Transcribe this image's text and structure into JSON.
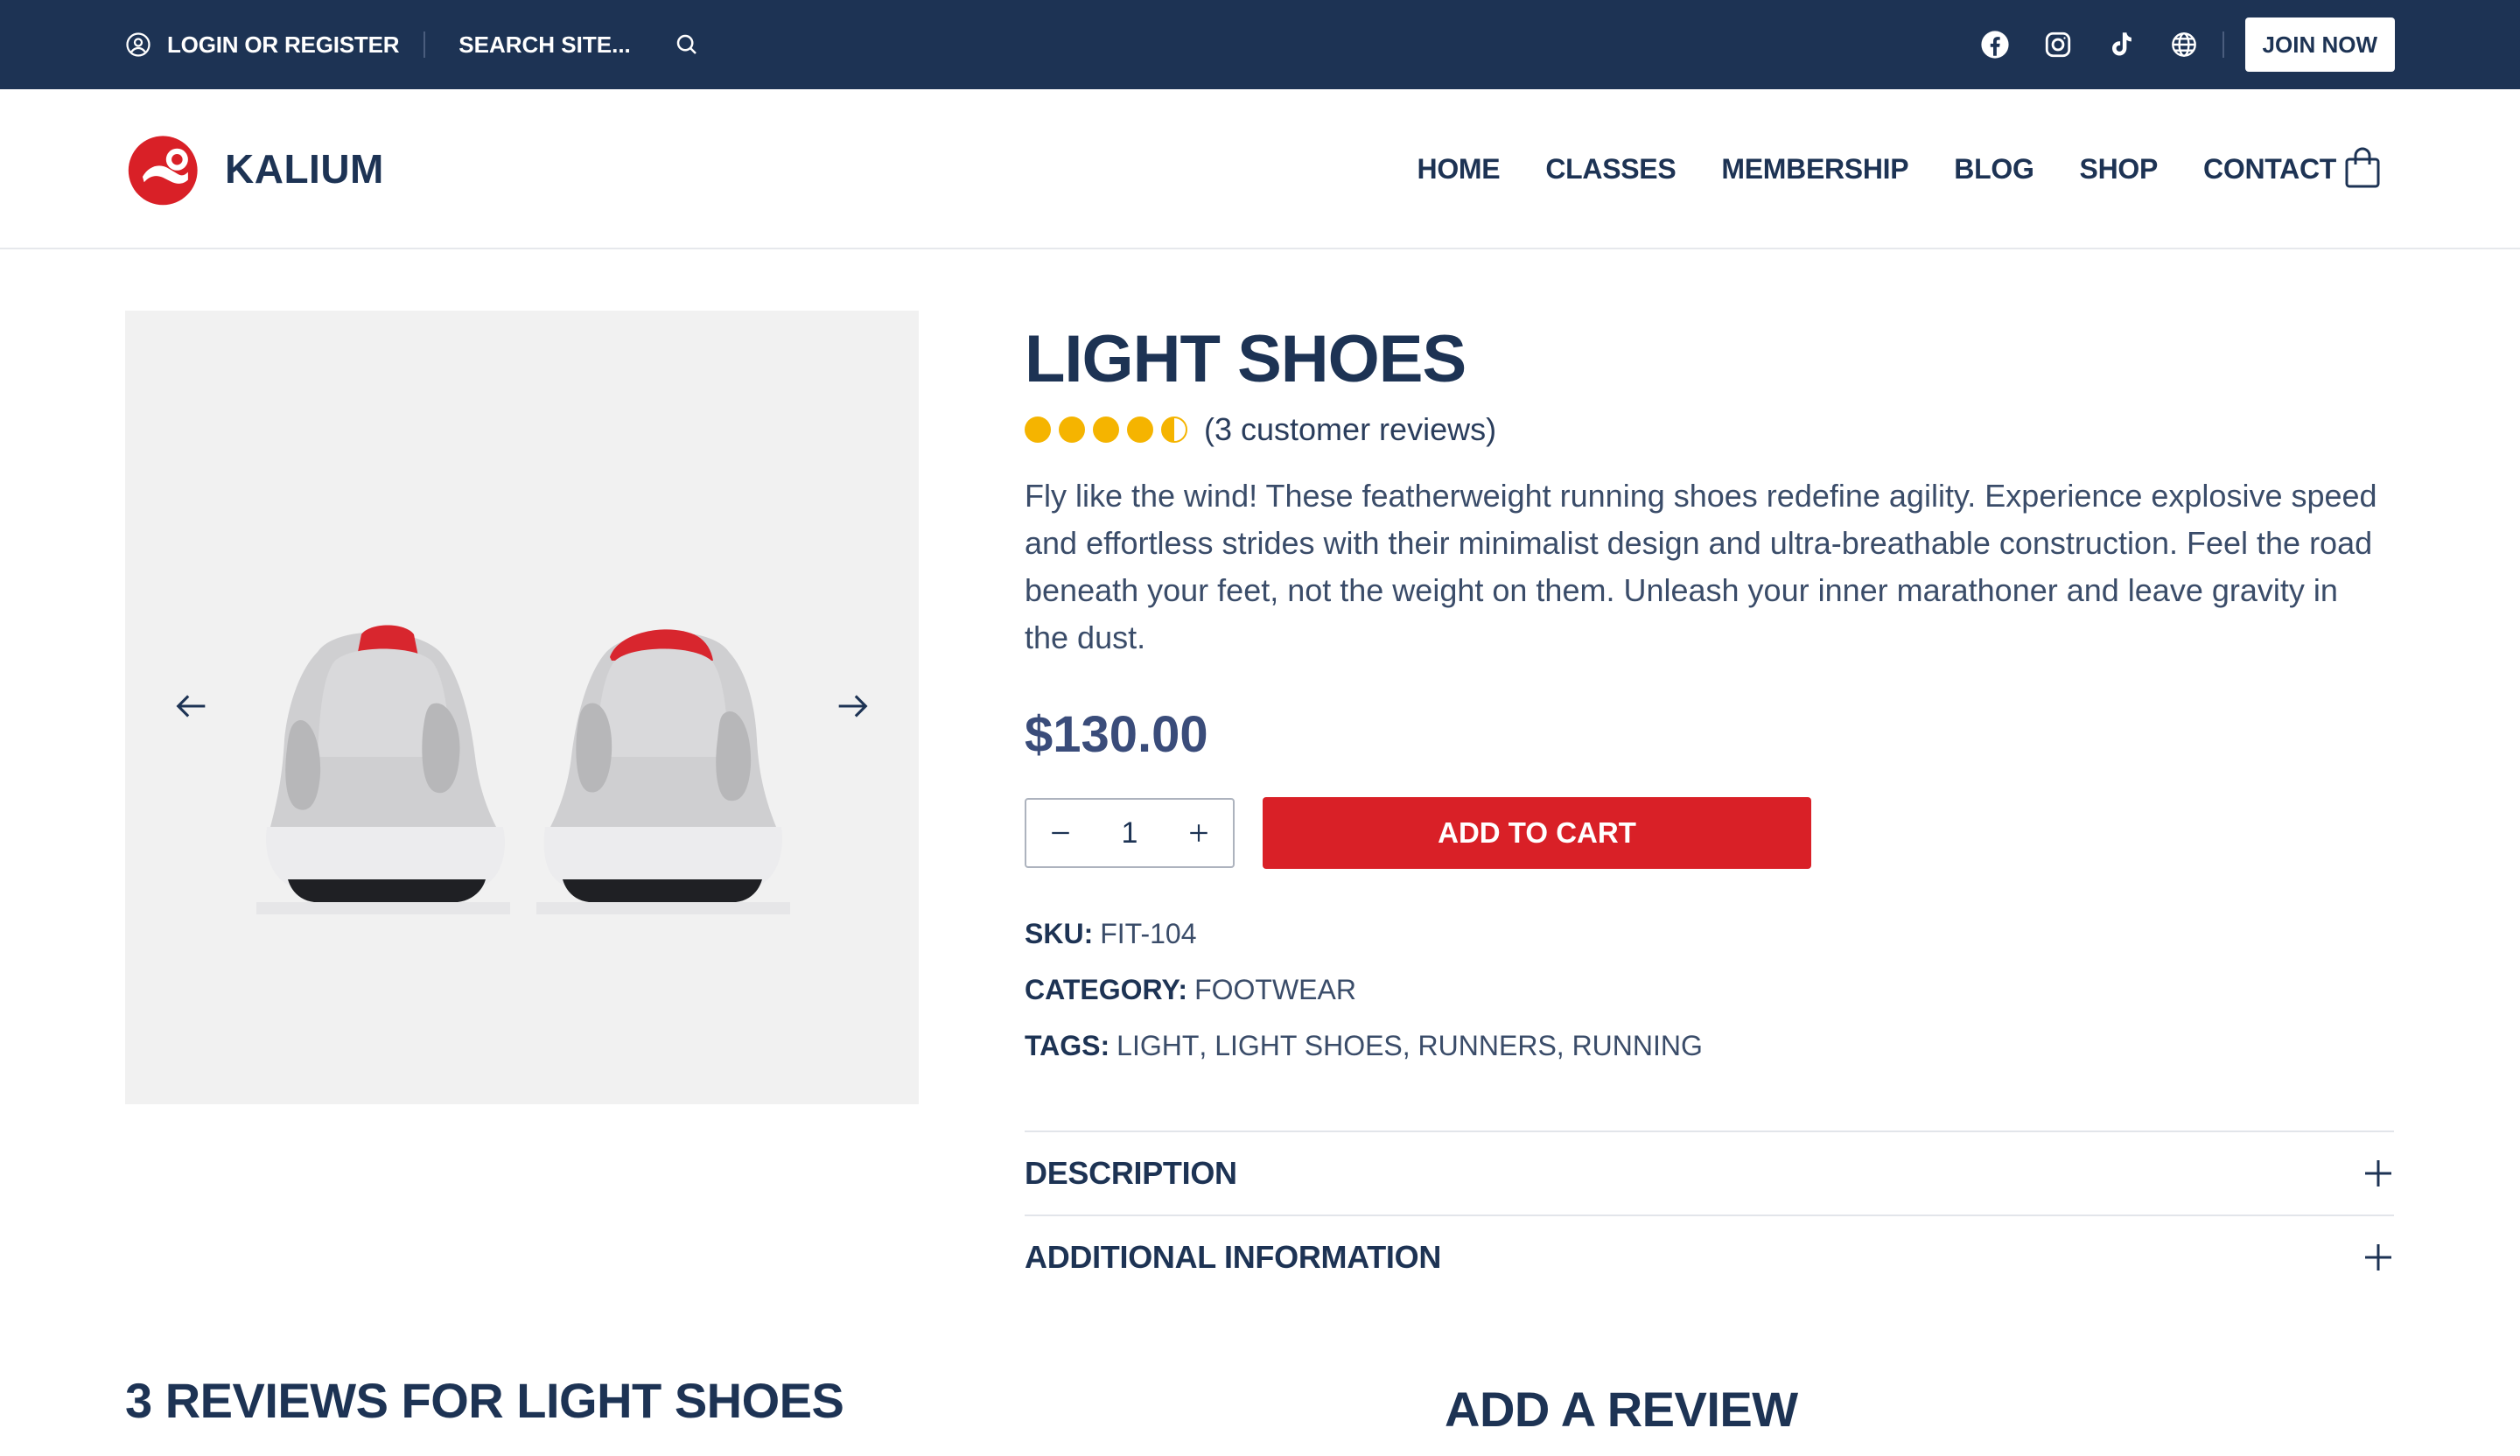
{
  "topbar": {
    "login_label": "LOGIN OR REGISTER",
    "search_placeholder": "SEARCH SITE...",
    "join_label": "JOIN NOW",
    "icons": [
      "user-icon",
      "search-icon",
      "facebook-icon",
      "instagram-icon",
      "tiktok-icon",
      "globe-icon"
    ]
  },
  "header": {
    "brand": "KALIUM",
    "nav": [
      "HOME",
      "CLASSES",
      "MEMBERSHIP",
      "BLOG",
      "SHOP",
      "CONTACT"
    ],
    "cart_icon": "shopping-bag-icon"
  },
  "product": {
    "title": "LIGHT SHOES",
    "rating": 4.5,
    "rating_max": 5,
    "reviews_text": "(3 customer reviews)",
    "description": "Fly like the wind! These featherweight running shoes redefine agility. Experience explosive speed and effortless strides with their minimalist design and ultra-breathable construction. Feel the road beneath your feet, not the weight on them. Unleash your inner marathoner and leave gravity in the dust.",
    "price": "$130.00",
    "quantity": "1",
    "add_to_cart_label": "ADD TO CART",
    "sku_label": "SKU:",
    "sku": "FIT-104",
    "category_label": "CATEGORY:",
    "category": "FOOTWEAR",
    "tags_label": "TAGS:",
    "tags": [
      "LIGHT",
      "LIGHT SHOES",
      "RUNNERS",
      "RUNNING"
    ]
  },
  "accordion": [
    "DESCRIPTION",
    "ADDITIONAL INFORMATION"
  ],
  "reviews_heading": "3 REVIEWS FOR LIGHT SHOES",
  "add_review_heading": "ADD A REVIEW",
  "colors": {
    "navy": "#1d3354",
    "accent_red": "#d92027",
    "star_gold": "#f5b400",
    "gallery_bg": "#f1f1f1"
  }
}
